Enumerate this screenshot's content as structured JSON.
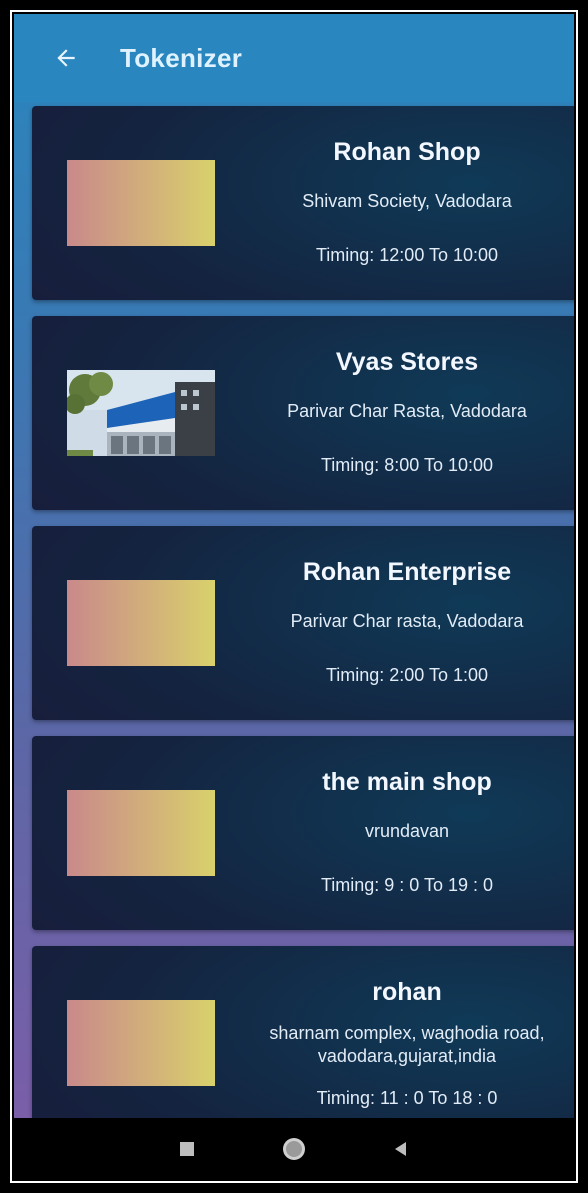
{
  "app_bar": {
    "title": "Tokenizer",
    "back_icon": "arrow-left-icon",
    "color": "#2a86be"
  },
  "shops": [
    {
      "name": "Rohan Shop",
      "address": "Shivam Society, Vadodara",
      "timing": "Timing: 12:00 To 10:00",
      "image": "placeholder-gradient"
    },
    {
      "name": "Vyas Stores",
      "address": "Parivar Char Rasta, Vadodara",
      "timing": "Timing: 8:00 To 10:00",
      "image": "store-photo"
    },
    {
      "name": "Rohan Enterprise",
      "address": "Parivar Char rasta, Vadodara",
      "timing": "Timing: 2:00 To 1:00",
      "image": "placeholder-gradient"
    },
    {
      "name": "the main shop",
      "address": "vrundavan",
      "timing": "Timing: 9 : 0 To 19 : 0",
      "image": "placeholder-gradient"
    },
    {
      "name": "rohan",
      "address": "sharnam complex, waghodia road, vadodara,gujarat,india",
      "timing": "Timing: 11 : 0 To 18 : 0",
      "image": "placeholder-gradient"
    }
  ],
  "nav_bar": {
    "recents_icon": "square-icon",
    "home_icon": "circle-icon",
    "back_icon": "triangle-back-icon"
  }
}
